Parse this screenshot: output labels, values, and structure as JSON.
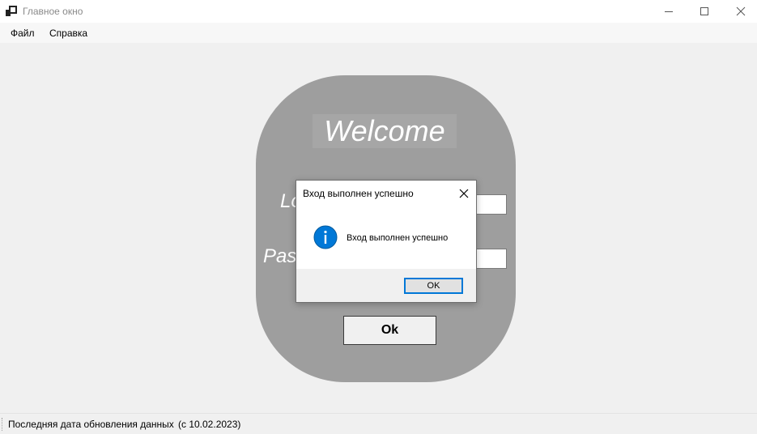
{
  "window": {
    "title": "Главное окно"
  },
  "menu": {
    "items": [
      {
        "label": "Файл"
      },
      {
        "label": "Справка"
      }
    ]
  },
  "login_panel": {
    "welcome": "Welcome",
    "login_label": "Lo",
    "password_label": "Pas",
    "login_value": "",
    "password_value": "",
    "ok_label": "Ok",
    "panel_color": "#9e9e9e"
  },
  "message_box": {
    "title": "Вход выполнен успешно",
    "message": "Вход выполнен успешно",
    "icon": "info-icon",
    "ok_label": "OK",
    "accent_color": "#0078d7"
  },
  "status_bar": {
    "text": "Последняя дата обновления данных",
    "date": "(с 10.02.2023)"
  }
}
